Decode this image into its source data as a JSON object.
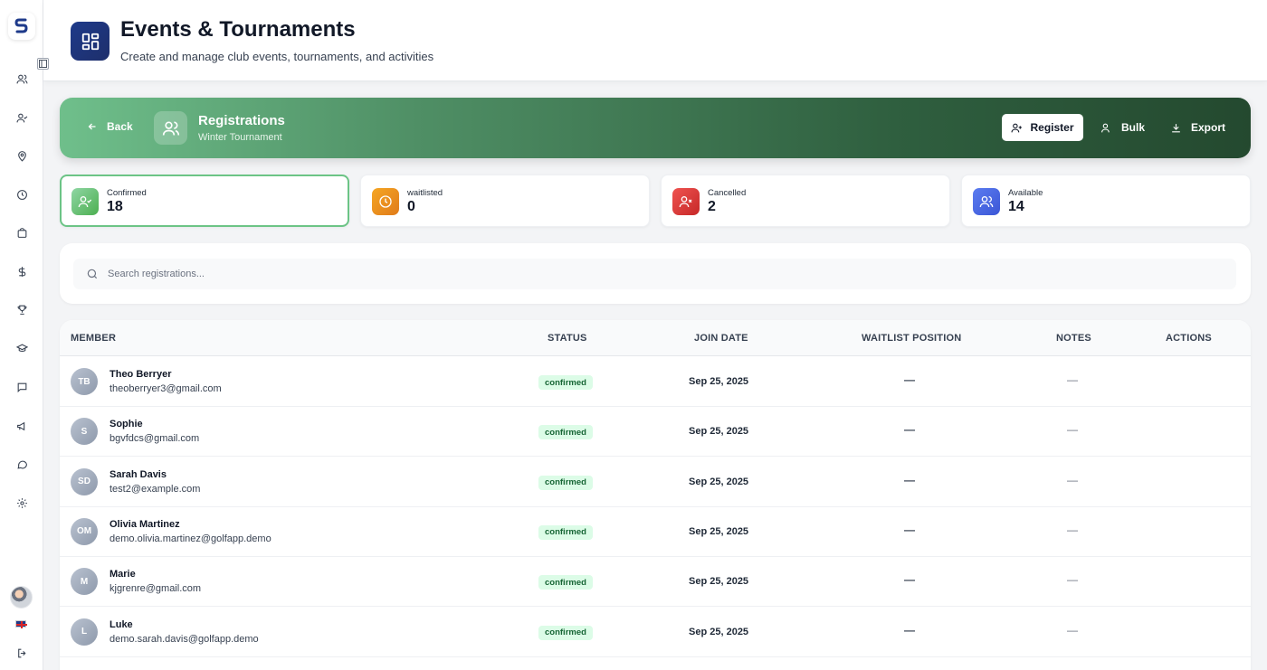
{
  "header": {
    "title": "Events & Tournaments",
    "subtitle": "Create and manage club events, tournaments, and activities"
  },
  "banner": {
    "back_label": "Back",
    "title": "Registrations",
    "subtitle": "Winter Tournament",
    "register_label": "Register",
    "bulk_label": "Bulk",
    "export_label": "Export"
  },
  "stats": [
    {
      "label": "Confirmed",
      "value": "18",
      "color": "#4caf50"
    },
    {
      "label": "waitlisted",
      "value": "0",
      "color": "#e8901f"
    },
    {
      "label": "Cancelled",
      "value": "2",
      "color": "#dc3b3b"
    },
    {
      "label": "Available",
      "value": "14",
      "color": "#4f6be8"
    }
  ],
  "search": {
    "placeholder": "Search registrations..."
  },
  "table": {
    "columns": [
      "MEMBER",
      "STATUS",
      "JOIN DATE",
      "WAITLIST POSITION",
      "NOTES",
      "ACTIONS"
    ],
    "rows": [
      {
        "initials": "TB",
        "name": "Theo Berryer",
        "email": "theoberryer3@gmail.com",
        "status": "confirmed",
        "join_date": "Sep 25, 2025",
        "waitlist": "—",
        "notes": "—"
      },
      {
        "initials": "S",
        "name": "Sophie",
        "email": "bgvfdcs@gmail.com",
        "status": "confirmed",
        "join_date": "Sep 25, 2025",
        "waitlist": "—",
        "notes": "—"
      },
      {
        "initials": "SD",
        "name": "Sarah Davis",
        "email": "test2@example.com",
        "status": "confirmed",
        "join_date": "Sep 25, 2025",
        "waitlist": "—",
        "notes": "—"
      },
      {
        "initials": "OM",
        "name": "Olivia Martinez",
        "email": "demo.olivia.martinez@golfapp.demo",
        "status": "confirmed",
        "join_date": "Sep 25, 2025",
        "waitlist": "—",
        "notes": "—"
      },
      {
        "initials": "M",
        "name": "Marie",
        "email": "kjgrenre@gmail.com",
        "status": "confirmed",
        "join_date": "Sep 25, 2025",
        "waitlist": "—",
        "notes": "—"
      },
      {
        "initials": "L",
        "name": "Luke",
        "email": "demo.sarah.davis@golfapp.demo",
        "status": "confirmed",
        "join_date": "Sep 25, 2025",
        "waitlist": "—",
        "notes": "—"
      }
    ]
  },
  "sidebar": {
    "icons": [
      "users-icon",
      "user-check-icon",
      "map-pin-icon",
      "clock-icon",
      "shopping-bag-icon",
      "dollar-icon",
      "trophy-icon",
      "graduation-cap-icon",
      "message-square-icon",
      "megaphone-icon",
      "message-circle-icon",
      "settings-icon"
    ]
  }
}
